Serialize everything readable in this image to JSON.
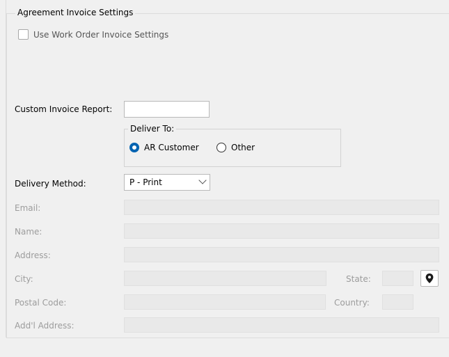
{
  "group": {
    "title": "Agreement Invoice Settings"
  },
  "use_work_order": {
    "label": "Use Work Order Invoice Settings"
  },
  "custom_invoice_report": {
    "label": "Custom Invoice Report:",
    "value": ""
  },
  "deliver_to": {
    "title": "Deliver To:",
    "options": [
      {
        "label": "AR Customer",
        "selected": true
      },
      {
        "label": "Other",
        "selected": false
      }
    ]
  },
  "delivery_method": {
    "label": "Delivery Method:",
    "value": "P - Print"
  },
  "fields": {
    "email": "Email:",
    "name": "Name:",
    "address": "Address:",
    "city": "City:",
    "state": "State:",
    "postal_code": "Postal Code:",
    "country": "Country:",
    "addl_address": "Add'l Address:"
  },
  "icons": {
    "location": "map-pin-icon"
  },
  "colors": {
    "accent": "#0063b1",
    "disabled_text": "#9c9c9c",
    "disabled_field": "#e9e9e9"
  }
}
